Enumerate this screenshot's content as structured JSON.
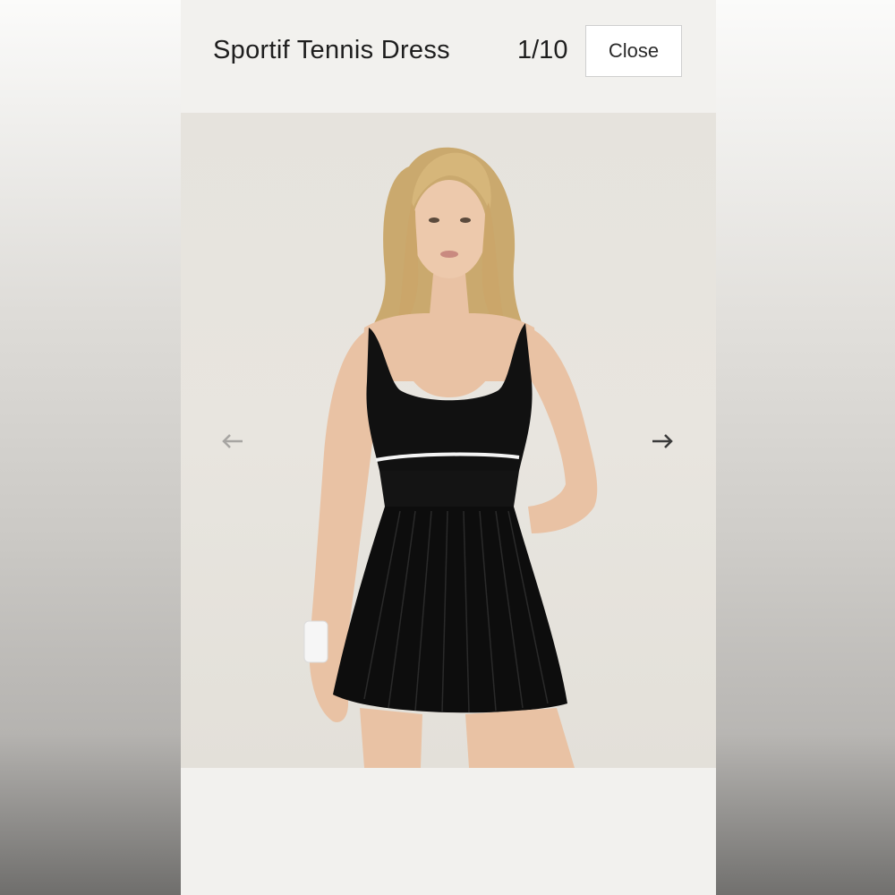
{
  "viewer": {
    "title": "Sportif Tennis Dress",
    "counter": "1/10",
    "close_label": "Close"
  },
  "carousel": {
    "prev_icon": "arrow-left-icon",
    "next_icon": "arrow-right-icon",
    "prev_enabled": false,
    "next_enabled": true
  },
  "image": {
    "subject": "model wearing black tennis dress with white piping and pleated skirt, white wristband",
    "background_color": "#e6e3dd",
    "dress_color": "#111111",
    "piping_color": "#f4f4f4"
  }
}
